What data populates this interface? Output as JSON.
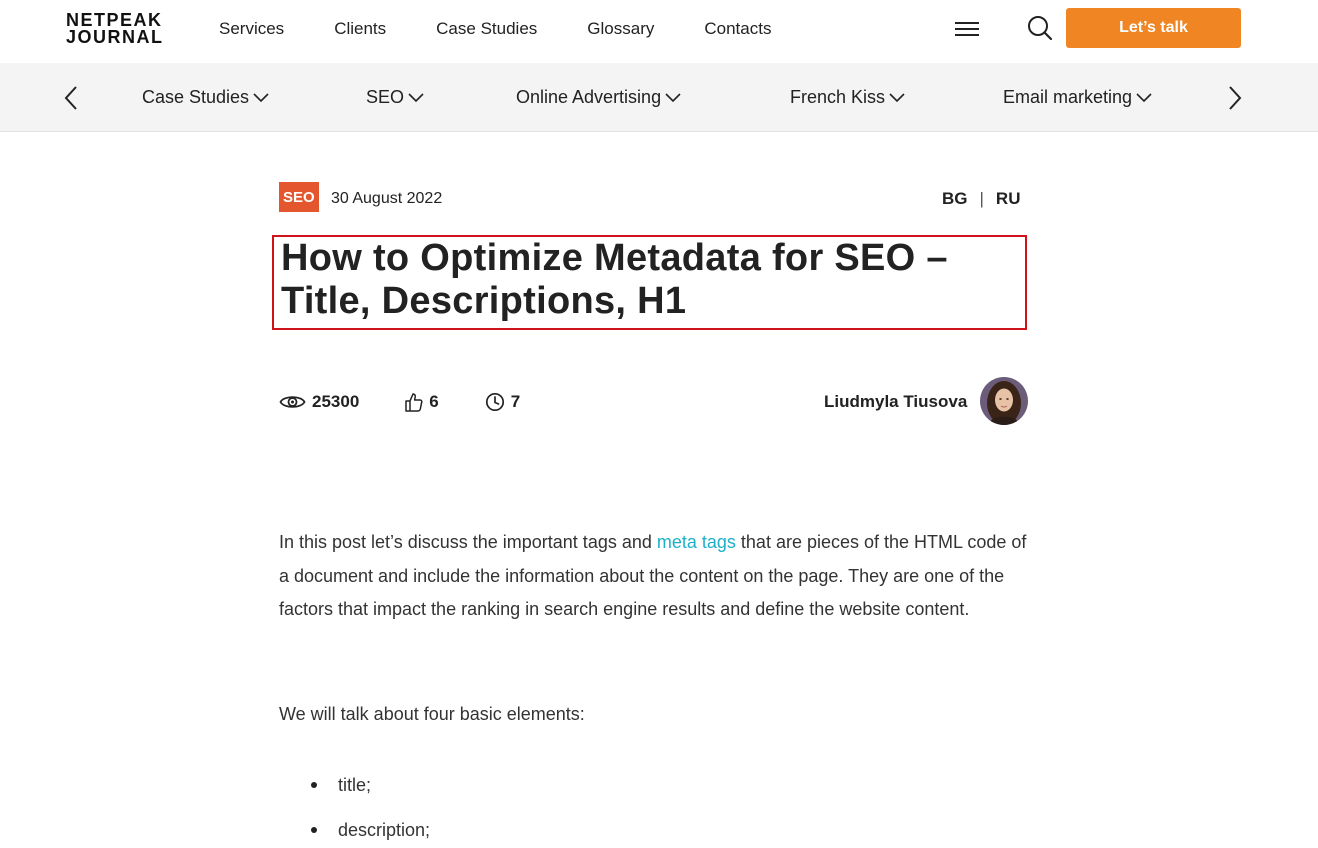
{
  "header": {
    "logo_line1": "NETPEAK",
    "logo_line2": "JOURNAL",
    "nav": [
      "Services",
      "Clients",
      "Case Studies",
      "Glossary",
      "Contacts"
    ],
    "cta_label": "Let’s talk",
    "menu_icon": "hamburger-menu-icon",
    "search_icon": "search-icon",
    "accent_color": "#f08523"
  },
  "categories": {
    "items": [
      "Case Studies",
      "SEO",
      "Online Advertising",
      "French Kiss",
      "Email marketing"
    ],
    "prev_icon": "chevron-left-icon",
    "next_icon": "chevron-right-icon"
  },
  "article": {
    "tag": "SEO",
    "tag_color": "#e4572e",
    "date": "30 August 2022",
    "languages": [
      "BG",
      "RU"
    ],
    "title": "How to Optimize Metadata for SEO – Title, Descriptions, H1",
    "stats": {
      "views": "25300",
      "likes": "6",
      "read_time": "7"
    },
    "author": "Liudmyla Tiusova",
    "intro_before_link": "In this post let’s discuss the important tags and ",
    "intro_link": "meta tags",
    "intro_after_link": " that are pieces of the HTML code of a document and include the information about the content on the page. They are one of the factors that impact the ranking in search engine results and define the website content.",
    "paragraph2": "We will talk about four basic elements:",
    "list": [
      "title;",
      "description;"
    ]
  }
}
